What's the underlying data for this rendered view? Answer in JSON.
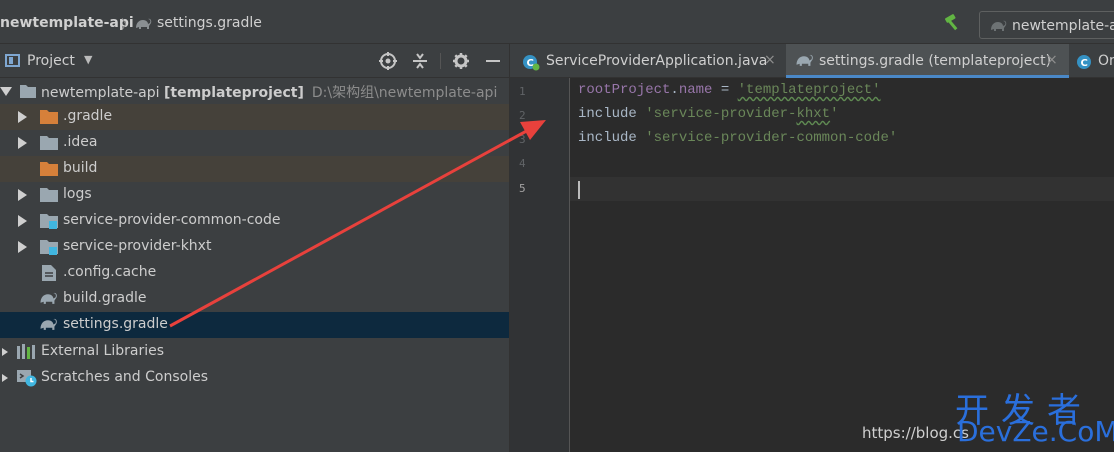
{
  "navbar": {
    "root_label": "newtemplate-api",
    "separator": "〉",
    "file_label": "settings.gradle",
    "run_config_label": "newtemplate-a"
  },
  "project_panel": {
    "title": "Project",
    "caret": "▼",
    "tree": [
      {
        "label": "newtemplate-api",
        "suffix": "[templateproject]",
        "hint": "D:\\架构组\\newtemplate-api",
        "icon": "folder-icon",
        "expanded": true
      },
      {
        "label": ".gradle",
        "icon": "folder-excluded-icon",
        "expanded": false
      },
      {
        "label": ".idea",
        "icon": "folder-icon",
        "expanded": false
      },
      {
        "label": "build",
        "icon": "folder-excluded-icon"
      },
      {
        "label": "logs",
        "icon": "folder-icon",
        "expanded": false
      },
      {
        "label": "service-provider-common-code",
        "icon": "module-folder-icon",
        "expanded": false
      },
      {
        "label": "service-provider-khxt",
        "icon": "module-folder-icon",
        "expanded": false
      },
      {
        "label": ".config.cache",
        "icon": "file-icon"
      },
      {
        "label": "build.gradle",
        "icon": "gradle-icon"
      },
      {
        "label": "settings.gradle",
        "icon": "gradle-icon",
        "selected": true
      },
      {
        "label": "External Libraries",
        "icon": "libraries-icon",
        "expanded": false
      },
      {
        "label": "Scratches and Consoles",
        "icon": "scratches-icon",
        "expanded": false
      }
    ]
  },
  "editor": {
    "tabs": [
      {
        "label": "ServiceProviderApplication.java",
        "close": "×",
        "icon": "spring-class-icon"
      },
      {
        "label": "settings.gradle (templateproject)",
        "close": "×",
        "icon": "gradle-icon",
        "active": true
      },
      {
        "label": "On",
        "icon": "class-icon"
      }
    ],
    "line_numbers": [
      "1",
      "2",
      "3",
      "4",
      "5"
    ],
    "code": {
      "line1": {
        "prop": "rootProject",
        "dot": ".",
        "prop2": "name",
        "eq": " = ",
        "str": "'templateproject'"
      },
      "line2": {
        "kw": "include ",
        "str_a": "'service-provider-",
        "str_b": "khxt",
        "str_c": "'"
      },
      "line3": {
        "kw": "include ",
        "str": "'service-provider-common-code'"
      }
    }
  },
  "watermark": {
    "url": "https://blog.cs",
    "chinese": "开发者",
    "brand": "DevZe.CoM"
  },
  "colors": {
    "accent": "#4a88c7",
    "annotation_arrow": "#e8413c",
    "watermark": "#2a6fdc"
  }
}
